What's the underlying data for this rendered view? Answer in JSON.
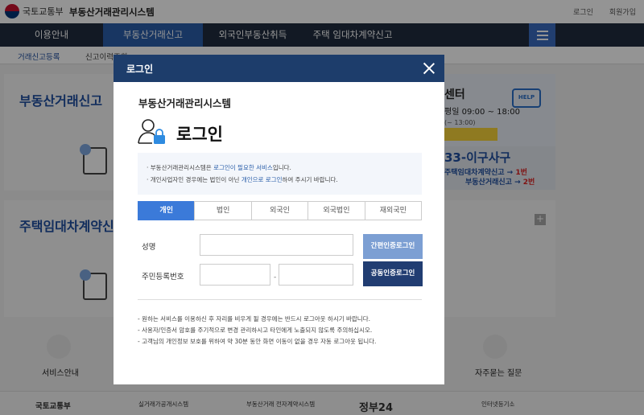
{
  "header": {
    "ministry": "국토교통부",
    "site_name": "부동산거래관리시스템",
    "links": [
      "로그인",
      "회원가입"
    ]
  },
  "main_nav": {
    "items": [
      "이용안내",
      "부동산거래신고",
      "외국인부동산취득",
      "주택 임대차계약신고"
    ],
    "active_index": 1
  },
  "sub_nav": [
    "거래신고등록",
    "신고이력조회"
  ],
  "background": {
    "panel1_title": "부동산거래신고",
    "panel2_title": "주택임대차계약신고",
    "help_title": "센터",
    "help_hours": "평일 09:00 ~ 18:00",
    "help_lunch": "(~ 13:00)",
    "help_badge": "HELP",
    "phone": "33-이구사구",
    "phone_line1_a": "주택임대차계약신고",
    "phone_line1_b": "1번",
    "phone_line2_a": "부동산거래신고",
    "phone_line2_b": "2번",
    "services": [
      "서비스안내",
      "자주묻는 질문"
    ],
    "footer_logos": [
      "국토교통부",
      "실거래가공개시스템",
      "부동산거래 전자계약시스템",
      "정부24",
      "인터넷등기소"
    ]
  },
  "modal": {
    "header_title": "로그인",
    "system_title": "부동산거래관리시스템",
    "login_title": "로그인",
    "notice": {
      "line1_prefix": "· 부동산거래관리시스템은 ",
      "line1_link": "로그인이 필요한 서비스",
      "line1_suffix": "입니다.",
      "line2_prefix": "· 개인사업자인 경우에는 법인이 아닌 ",
      "line2_link": "개인으로 로그인",
      "line2_suffix": "하여 주시기 바랍니다."
    },
    "tabs": [
      "개인",
      "법인",
      "외국인",
      "외국법인",
      "재외국민"
    ],
    "active_tab": 0,
    "form": {
      "name_label": "성명",
      "rrn_label": "주민등록번호",
      "name_value": "",
      "rrn_front_value": "",
      "rrn_back_value": "",
      "dash": "-"
    },
    "buttons": {
      "simple_auth": "간편인증로그인",
      "cert_auth": "공동인증로그인"
    },
    "info": [
      "- 원하는 서비스를 이용하신 후 자리를 비우게 될 경우에는 반드시 로그아웃 하시기 바랍니다.",
      "- 사용자/인증서 암호를 주기적으로 변경 관리하시고 타인에게 노출되지 않도록 주의하십시오.",
      "- 고객님의 개인정보 보호를 위하여 약 30분 동안 화면 이동이 없을 경우 자동 로그아웃 됩니다."
    ]
  }
}
